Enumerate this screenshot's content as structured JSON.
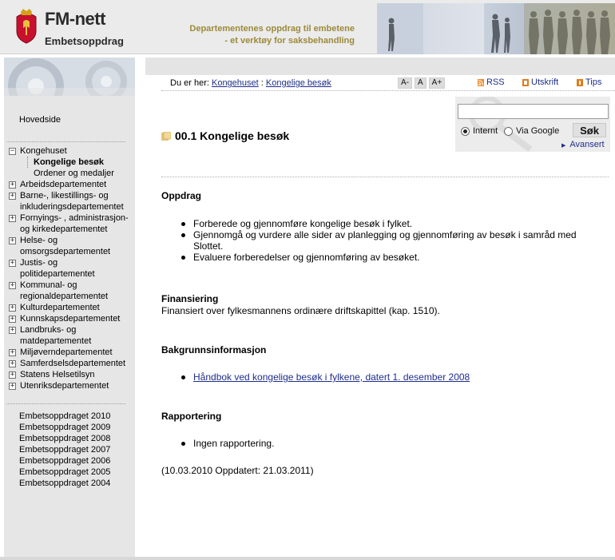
{
  "header": {
    "brand_title": "FM-nett",
    "brand_subtitle": "Embetsoppdrag",
    "tagline_line1": "Departementenes oppdrag til embetene",
    "tagline_line2": "- et verktøy for saksbehandling",
    "accent_color": "#9c8a3a"
  },
  "breadcrumb": {
    "prefix": "Du er her:",
    "items": [
      "Kongehuset",
      "Kongelige besøk"
    ],
    "separator": ":"
  },
  "font_size_buttons": [
    "A-",
    "A",
    "A+"
  ],
  "tools": {
    "rss": "RSS",
    "print": "Utskrift",
    "tips": "Tips"
  },
  "search": {
    "placeholder": "",
    "radio_internal": "Internt",
    "radio_google": "Via Google",
    "selected": "Internt",
    "button": "Søk",
    "advanced": "Avansert"
  },
  "sidebar": {
    "home": "Hovedside",
    "tree": [
      {
        "label": "Kongehuset",
        "toggle": "⊟",
        "expanded": true,
        "children": [
          {
            "label": "Kongelige besøk",
            "current": true
          },
          {
            "label": "Ordener og medaljer",
            "current": false
          }
        ]
      },
      {
        "label": "Arbeidsdepartementet",
        "toggle": "⊞"
      },
      {
        "label": "Barne-, likestillings- og inkluderingsdepartementet",
        "toggle": "⊞"
      },
      {
        "label": "Fornyings- , administrasjon- og kirkedepartementet",
        "toggle": "⊞"
      },
      {
        "label": "Helse- og omsorgsdepartementet",
        "toggle": "⊞"
      },
      {
        "label": "Justis- og politidepartementet",
        "toggle": "⊞"
      },
      {
        "label": "Kommunal- og regionaldepartementet",
        "toggle": "⊞"
      },
      {
        "label": "Kulturdepartementet",
        "toggle": "⊞"
      },
      {
        "label": "Kunnskapsdepartementet",
        "toggle": "⊞"
      },
      {
        "label": "Landbruks- og matdepartementet",
        "toggle": "⊞"
      },
      {
        "label": "Miljøverndepartementet",
        "toggle": "⊞"
      },
      {
        "label": "Samferdselsdepartementet",
        "toggle": "⊞"
      },
      {
        "label": "Statens Helsetilsyn",
        "toggle": "⊞"
      },
      {
        "label": "Utenriksdepartementet",
        "toggle": "⊞"
      }
    ],
    "years": [
      "Embetsoppdraget 2010",
      "Embetsoppdraget 2009",
      "Embetsoppdraget 2008",
      "Embetsoppdraget 2007",
      "Embetsoppdraget 2006",
      "Embetsoppdraget 2005",
      "Embetsoppdraget 2004"
    ]
  },
  "main": {
    "title": "00.1 Kongelige besøk",
    "oppdrag_heading": "Oppdrag",
    "oppdrag_items": [
      "Forberede og gjennomføre kongelige besøk i fylket.",
      "Gjennomgå og vurdere alle sider av planlegging og gjennomføring av besøk i samråd med Slottet.",
      "Evaluere forberedelser og gjennomføring av besøket."
    ],
    "finansiering_heading": "Finansiering",
    "finansiering_text": "Finansiert over fylkesmannens ordinære driftskapittel (kap. 1510).",
    "bakgrunn_heading": "Bakgrunnsinformasjon",
    "bakgrunn_link": "Håndbok ved kongelige besøk i fylkene, datert 1. desember 2008",
    "rapportering_heading": "Rapportering",
    "rapportering_items": [
      "Ingen rapportering."
    ],
    "dates": "(10.03.2010 Oppdatert: 21.03.2011)"
  }
}
